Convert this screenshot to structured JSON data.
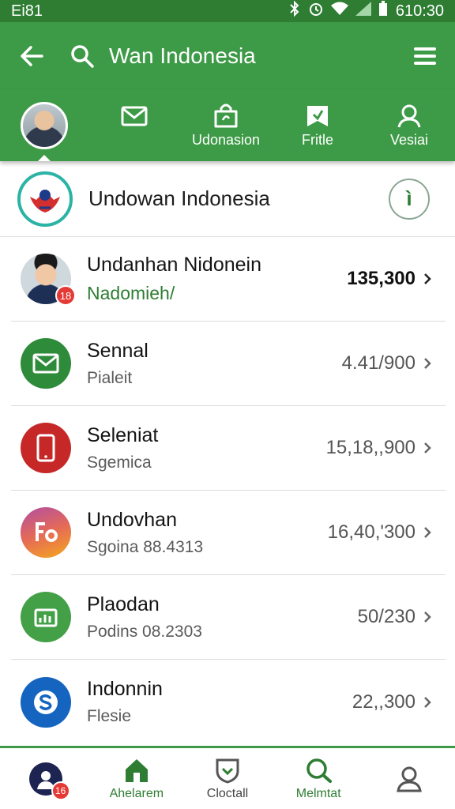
{
  "status_bar": {
    "left_text": "Ei81",
    "time": "610:30"
  },
  "app_bar": {
    "title": "Wan Indonesia"
  },
  "tabs": [
    {
      "label": "",
      "icon": "mail-icon"
    },
    {
      "label": "Udonasion",
      "icon": "bag-icon"
    },
    {
      "label": "Fritle",
      "icon": "bookmark-icon"
    },
    {
      "label": "Vesiai",
      "icon": "user-icon"
    }
  ],
  "header": {
    "title": "Undowan Indonesia",
    "info_glyph": "ì"
  },
  "list": [
    {
      "title": "Undanhan Nidonein",
      "subtitle": "Nadomieh/",
      "value": "135,300",
      "badge": "18",
      "icon": "avatar",
      "color": "#c62828"
    },
    {
      "title": "Sennal",
      "subtitle": "Pialeit",
      "value": "4.41/900",
      "icon": "mail-icon",
      "color": "#2e8b3a"
    },
    {
      "title": "Seleniat",
      "subtitle": "Sgemica",
      "value": "15,18,,900",
      "icon": "phone-icon",
      "color": "#c62828"
    },
    {
      "title": "Undovhan",
      "subtitle": "Sgoina 88.4313",
      "value": "16,40,'300",
      "icon": "fo-app-icon",
      "color": "#f4a81d"
    },
    {
      "title": "Plaodan",
      "subtitle": "Podins 08.2303",
      "value": "50/230",
      "icon": "bar-chart-icon",
      "color": "#43a047"
    },
    {
      "title": "Indonnin",
      "subtitle": "Flesie",
      "value": "22,,300",
      "icon": "s-app-icon",
      "color": "#1565c0"
    }
  ],
  "bottom_nav": [
    {
      "label": "",
      "badge": "16",
      "icon": "profile-avatar"
    },
    {
      "label": "Ahelarem",
      "icon": "home-icon"
    },
    {
      "label": "Cloctall",
      "icon": "shield-icon"
    },
    {
      "label": "Melmtat",
      "icon": "chat-search-icon"
    },
    {
      "label": "",
      "icon": "person-icon"
    }
  ],
  "colors": {
    "primary": "#3d9a47",
    "primary_dark": "#2e7d32",
    "accent_red": "#e53935"
  }
}
